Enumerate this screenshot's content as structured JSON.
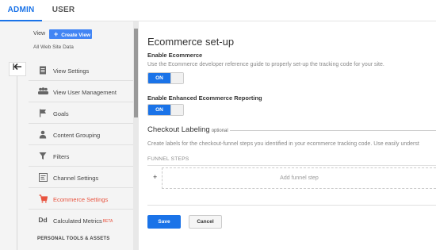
{
  "tabs": {
    "admin": "ADMIN",
    "user": "USER"
  },
  "sidebar": {
    "view_label": "View",
    "create_view_label": "Create View",
    "view_name": "All Web Site Data",
    "back_icon": "back-arrow-icon",
    "items": [
      {
        "label": "View Settings",
        "icon": "document-icon",
        "active": false
      },
      {
        "label": "View User Management",
        "icon": "users-icon",
        "active": false
      },
      {
        "label": "Goals",
        "icon": "flag-icon",
        "active": false
      },
      {
        "label": "Content Grouping",
        "icon": "person-icon",
        "active": false
      },
      {
        "label": "Filters",
        "icon": "filter-icon",
        "active": false
      },
      {
        "label": "Channel Settings",
        "icon": "channel-icon",
        "active": false
      },
      {
        "label": "Ecommerce Settings",
        "icon": "cart-icon",
        "active": true
      },
      {
        "label": "Calculated Metrics",
        "badge": "BETA",
        "icon": "dd-icon",
        "active": false
      }
    ],
    "section_head": "PERSONAL TOOLS & ASSETS"
  },
  "main": {
    "title": "Ecommerce set-up",
    "enable_ecommerce": {
      "label": "Enable Ecommerce",
      "description": "Use the Ecommerce developer reference guide to properly set-up the tracking code for your site.",
      "toggle": "ON"
    },
    "enhanced": {
      "label": "Enable Enhanced Ecommerce Reporting",
      "toggle": "ON"
    },
    "checkout": {
      "title": "Checkout Labeling",
      "optional": "optional",
      "description": "Create labels for the checkout-funnel steps you identified in your ecommerce tracking code. Use easily underst",
      "funnel_label": "FUNNEL STEPS",
      "plus": "+",
      "add_step": "Add funnel step"
    },
    "save_label": "Save",
    "cancel_label": "Cancel"
  },
  "colors": {
    "accent": "#1a73e8",
    "active_nav": "#e8533f"
  }
}
